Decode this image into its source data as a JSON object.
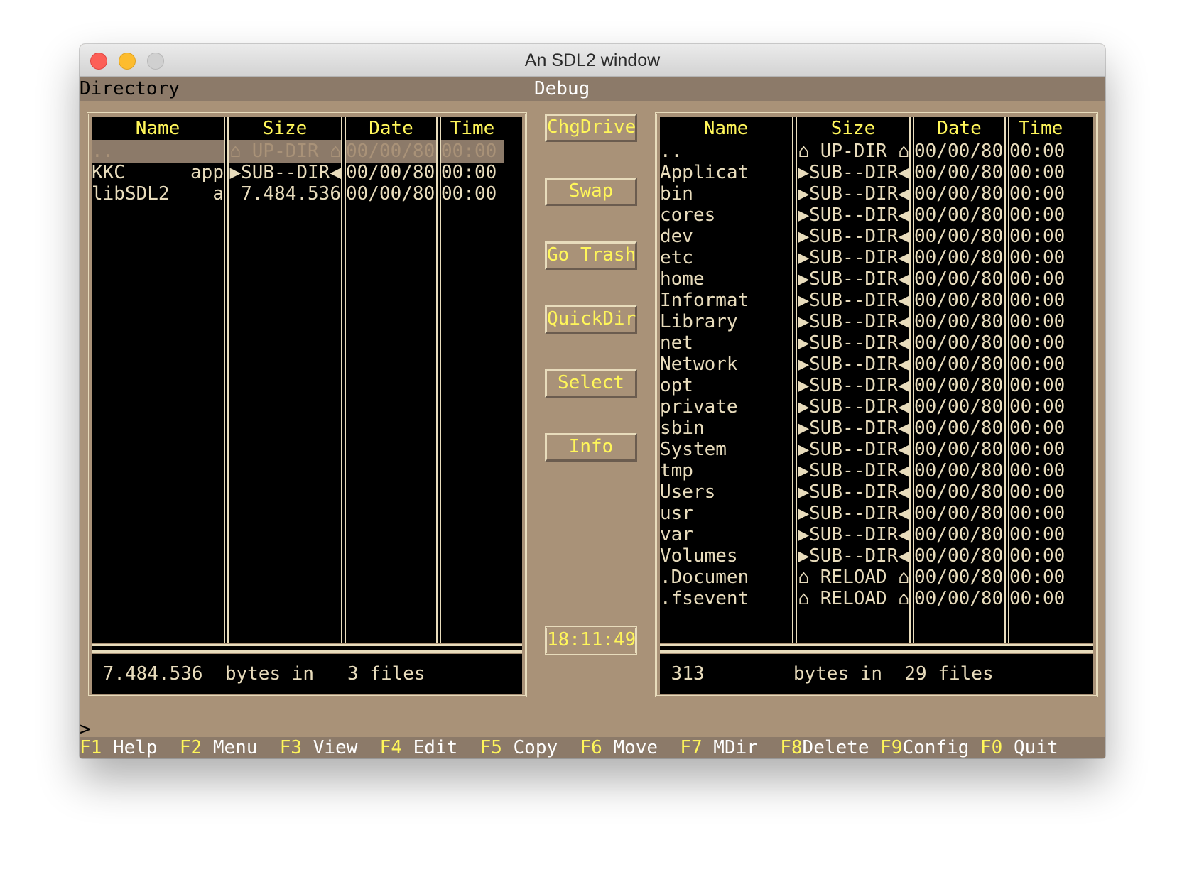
{
  "window": {
    "title": "An SDL2 window"
  },
  "menubar": {
    "left": "Directory",
    "center": "Debug"
  },
  "columns": {
    "name": "Name",
    "size": "Size",
    "date": "Date",
    "time": "Time"
  },
  "left_panel": {
    "rows": [
      {
        "name": "..",
        "ext": "",
        "size": "⌂ UP-DIR ⌂",
        "date": "00/00/80",
        "time": "00:00",
        "selected": true
      },
      {
        "name": "KKC",
        "ext": "app",
        "size": "▶SUB--DIR◀",
        "date": "00/00/80",
        "time": "00:00"
      },
      {
        "name": "libSDL2",
        "ext": "a",
        "size": "7.484.536",
        "date": "00/00/80",
        "time": "00:00"
      }
    ],
    "status": " 7.484.536  bytes in   3 files"
  },
  "right_panel": {
    "rows": [
      {
        "name": "..",
        "size": "⌂ UP-DIR ⌂",
        "date": "00/00/80",
        "time": "00:00"
      },
      {
        "name": "Applicat",
        "size": "▶SUB--DIR◀",
        "date": "00/00/80",
        "time": "00:00"
      },
      {
        "name": "bin",
        "size": "▶SUB--DIR◀",
        "date": "00/00/80",
        "time": "00:00"
      },
      {
        "name": "cores",
        "size": "▶SUB--DIR◀",
        "date": "00/00/80",
        "time": "00:00"
      },
      {
        "name": "dev",
        "size": "▶SUB--DIR◀",
        "date": "00/00/80",
        "time": "00:00"
      },
      {
        "name": "etc",
        "size": "▶SUB--DIR◀",
        "date": "00/00/80",
        "time": "00:00"
      },
      {
        "name": "home",
        "size": "▶SUB--DIR◀",
        "date": "00/00/80",
        "time": "00:00"
      },
      {
        "name": "Informat",
        "size": "▶SUB--DIR◀",
        "date": "00/00/80",
        "time": "00:00"
      },
      {
        "name": "Library",
        "size": "▶SUB--DIR◀",
        "date": "00/00/80",
        "time": "00:00"
      },
      {
        "name": "net",
        "size": "▶SUB--DIR◀",
        "date": "00/00/80",
        "time": "00:00"
      },
      {
        "name": "Network",
        "size": "▶SUB--DIR◀",
        "date": "00/00/80",
        "time": "00:00"
      },
      {
        "name": "opt",
        "size": "▶SUB--DIR◀",
        "date": "00/00/80",
        "time": "00:00"
      },
      {
        "name": "private",
        "size": "▶SUB--DIR◀",
        "date": "00/00/80",
        "time": "00:00"
      },
      {
        "name": "sbin",
        "size": "▶SUB--DIR◀",
        "date": "00/00/80",
        "time": "00:00"
      },
      {
        "name": "System",
        "size": "▶SUB--DIR◀",
        "date": "00/00/80",
        "time": "00:00"
      },
      {
        "name": "tmp",
        "size": "▶SUB--DIR◀",
        "date": "00/00/80",
        "time": "00:00"
      },
      {
        "name": "Users",
        "size": "▶SUB--DIR◀",
        "date": "00/00/80",
        "time": "00:00"
      },
      {
        "name": "usr",
        "size": "▶SUB--DIR◀",
        "date": "00/00/80",
        "time": "00:00"
      },
      {
        "name": "var",
        "size": "▶SUB--DIR◀",
        "date": "00/00/80",
        "time": "00:00"
      },
      {
        "name": "Volumes",
        "size": "▶SUB--DIR◀",
        "date": "00/00/80",
        "time": "00:00"
      },
      {
        "name": ".Documen",
        "size": "⌂ RELOAD ⌂",
        "date": "00/00/80",
        "time": "00:00"
      },
      {
        "name": ".fsevent",
        "size": "⌂ RELOAD ⌂",
        "date": "00/00/80",
        "time": "00:00"
      }
    ],
    "status": " 313        bytes in  29 files"
  },
  "buttons": {
    "chgdrive": "ChgDrive",
    "swap": "Swap",
    "gotrash": "Go Trash",
    "quickdir": "QuickDir",
    "select": "Select",
    "info": "Info"
  },
  "clock": "18:11:49",
  "prompt": ">",
  "function_keys": [
    {
      "key": "F1",
      "label": " Help  "
    },
    {
      "key": "F2",
      "label": " Menu  "
    },
    {
      "key": "F3",
      "label": " View  "
    },
    {
      "key": "F4",
      "label": " Edit  "
    },
    {
      "key": "F5",
      "label": " Copy  "
    },
    {
      "key": "F6",
      "label": " Move  "
    },
    {
      "key": "F7",
      "label": " MDir  "
    },
    {
      "key": "F8",
      "label": "Delete "
    },
    {
      "key": "F9",
      "label": "Config "
    },
    {
      "key": "F0",
      "label": " Quit"
    }
  ]
}
